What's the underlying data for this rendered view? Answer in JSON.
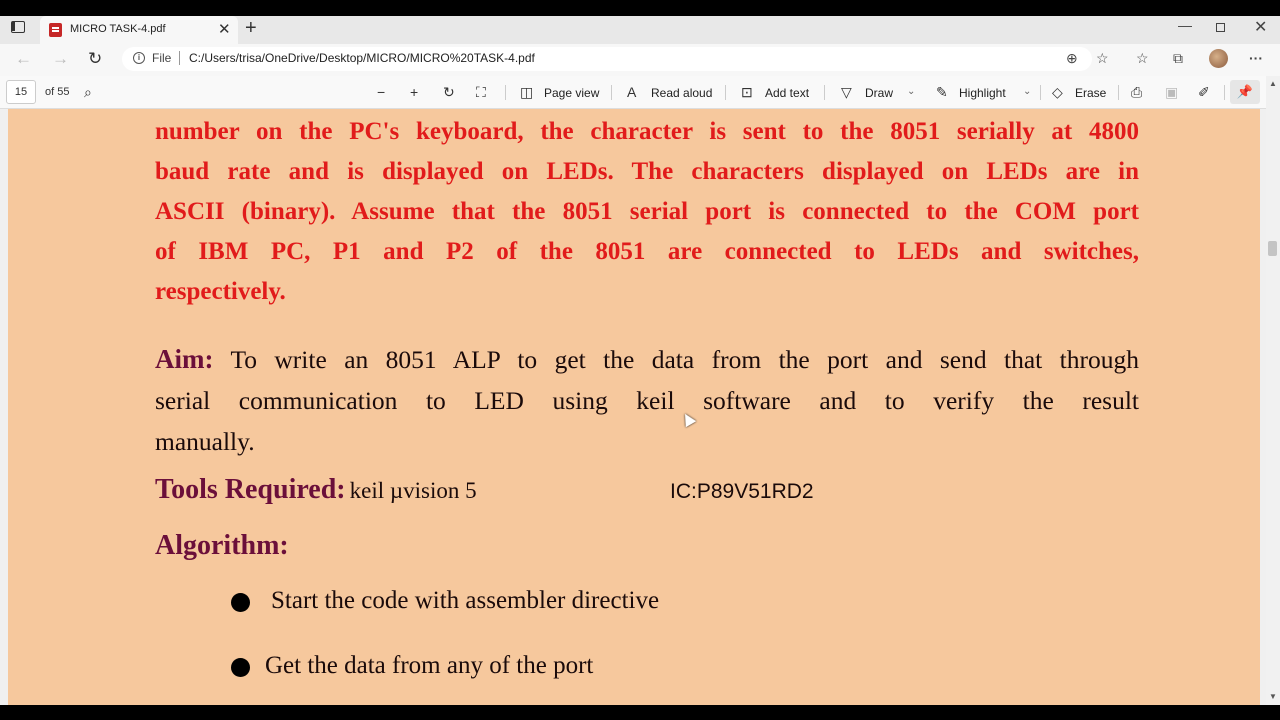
{
  "browser": {
    "tab_title": "MICRO TASK-4.pdf",
    "tab_close": "✕",
    "new_tab": "+",
    "address_label": "File",
    "url": "C:/Users/trisa/OneDrive/Desktop/MICRO/MICRO%20TASK-4.pdf",
    "window_min": "—",
    "window_close": "✕"
  },
  "pdf_toolbar": {
    "page_number": "15",
    "page_total": "of 55",
    "page_view": "Page view",
    "read_aloud": "Read aloud",
    "add_text": "Add text",
    "draw": "Draw",
    "highlight": "Highlight",
    "erase": "Erase"
  },
  "document": {
    "problem_lines": [
      "number on the PC's keyboard, the character is sent to the 8051 serially at 4800",
      "baud rate and is displayed on LEDs. The characters displayed on LEDs are in",
      "ASCII (binary). Assume that the 8051 serial port is connected to the COM port",
      "of IBM PC,  P1 and P2 of the 8051 are connected to LEDs and switches,",
      "respectively."
    ],
    "aim_heading": "Aim:",
    "aim_lines": [
      "To write an 8051 ALP to get the data from the port and send that through",
      "serial communication to LED using  keil  software and to verify the result",
      "manually."
    ],
    "tools_heading": "Tools Required:",
    "tools_value": "keil µvision 5",
    "ic_value": "IC:P89V51RD2",
    "algorithm_heading": "Algorithm:",
    "algorithm_steps": [
      "Start the code with assembler directive",
      "Get the data from any of the port"
    ]
  },
  "colors": {
    "page_background": "#f6c89d",
    "problem_text": "#e11b1b",
    "heading_text": "#6b0f3a"
  }
}
